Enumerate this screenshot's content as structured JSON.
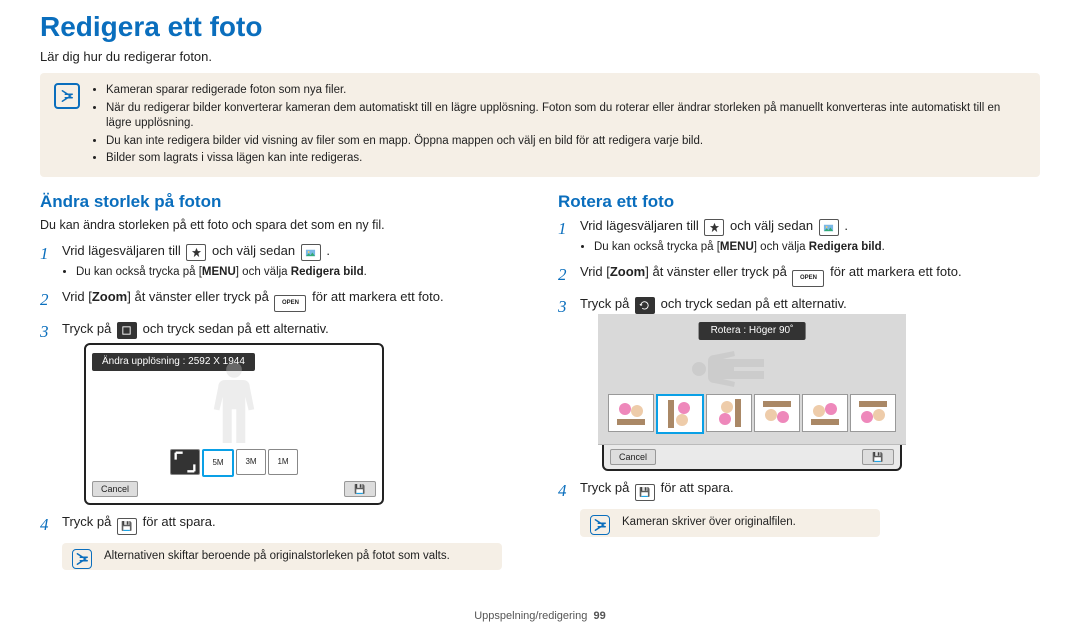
{
  "title": "Redigera ett foto",
  "intro": "Lär dig hur du redigerar foton.",
  "notes": [
    "Kameran sparar redigerade foton som nya filer.",
    "När du redigerar bilder konverterar kameran dem automatiskt till en lägre upplösning. Foton som du roterar eller ändrar storleken på manuellt konverteras inte automatiskt till en lägre upplösning.",
    "Du kan inte redigera bilder vid visning av filer som en mapp. Öppna mappen och välj en bild för att redigera varje bild.",
    "Bilder som lagrats i vissa lägen kan inte redigeras."
  ],
  "left": {
    "heading": "Ändra storlek på foton",
    "sub": "Du kan ändra storleken på ett foto och spara det som en ny fil.",
    "step1a": "Vrid lägesväljaren till ",
    "step1b": " och välj sedan ",
    "step1c": ".",
    "step1_sub_a": "Du kan också trycka på [",
    "step1_sub_menu": "MENU",
    "step1_sub_b": "] och välja ",
    "step1_sub_bold": "Redigera bild",
    "step1_sub_c": ".",
    "step2a": "Vrid [",
    "step2bold": "Zoom",
    "step2b": "] åt vänster eller tryck på ",
    "step2c": " för att markera ett foto.",
    "step3a": "Tryck på ",
    "step3b": " och tryck sedan på ett alternativ.",
    "screenshot_caption": "Ändra upplösning : 2592 X 1944",
    "cancel": "Cancel",
    "thumbs": [
      "↙",
      "5M",
      "3M",
      "1M"
    ],
    "open_label": "OPEN",
    "step4a": "Tryck på ",
    "step4b": " för att spara.",
    "tip": "Alternativen skiftar beroende på originalstorleken på fotot som valts."
  },
  "right": {
    "heading": "Rotera ett foto",
    "step1a": "Vrid lägesväljaren till ",
    "step1b": " och välj sedan ",
    "step1c": ".",
    "step1_sub_a": "Du kan också trycka på [",
    "step1_sub_menu": "MENU",
    "step1_sub_b": "] och välja ",
    "step1_sub_bold": "Redigera bild",
    "step1_sub_c": ".",
    "step2a": "Vrid [",
    "step2bold": "Zoom",
    "step2b": "] åt vänster eller tryck på ",
    "step2c": " för att markera ett foto.",
    "open_label": "OPEN",
    "step3a": "Tryck på ",
    "step3b": " och tryck sedan på ett alternativ.",
    "screenshot_caption": "Rotera : Höger 90˚",
    "cancel": "Cancel",
    "step4a": "Tryck på ",
    "step4b": " för att spara.",
    "tip": "Kameran skriver över originalfilen."
  },
  "footer_a": "Uppspelning/redigering",
  "footer_b": "99"
}
